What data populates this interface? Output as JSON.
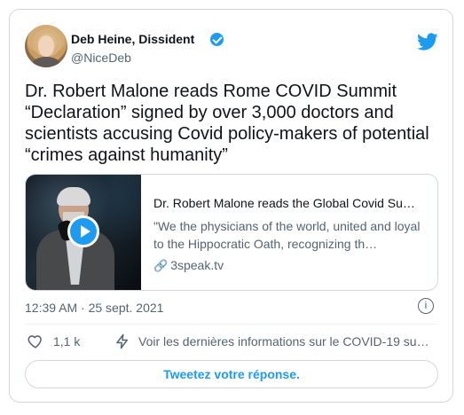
{
  "tweet": {
    "author": {
      "display_name": "Deb Heine, Dissident",
      "handle": "@NiceDeb",
      "avatar_icon": "profile-photo",
      "verified_icon": "verified-badge-icon"
    },
    "brand_icon": "twitter-bird-icon",
    "text": "Dr. Robert Malone reads Rome COVID Summit “Declaration” signed by over 3,000 doctors and scientists accusing Covid policy-makers of potential “crimes against humanity”",
    "link_card": {
      "title": "Dr. Robert Malone reads the Global Covid Su…",
      "description": "\"We the physicians of the world, united and loyal to the Hippocratic Oath, recognizing th…",
      "domain": "3speak.tv",
      "play_icon": "play-icon",
      "thumbnail_icon": "video-thumbnail"
    },
    "timestamp": "12:39 AM · 25 sept. 2021",
    "actions": {
      "like_icon": "heart-icon",
      "like_count": "1,1 k",
      "info_icon": "lightning-icon",
      "covid_info_text": "Voir les dernières informations sur le COVID-19 su…"
    },
    "reply_button": "Tweetez votre réponse."
  },
  "colors": {
    "accent": "#1d9bf0",
    "muted_text": "#536471",
    "border": "#cfd9de"
  }
}
